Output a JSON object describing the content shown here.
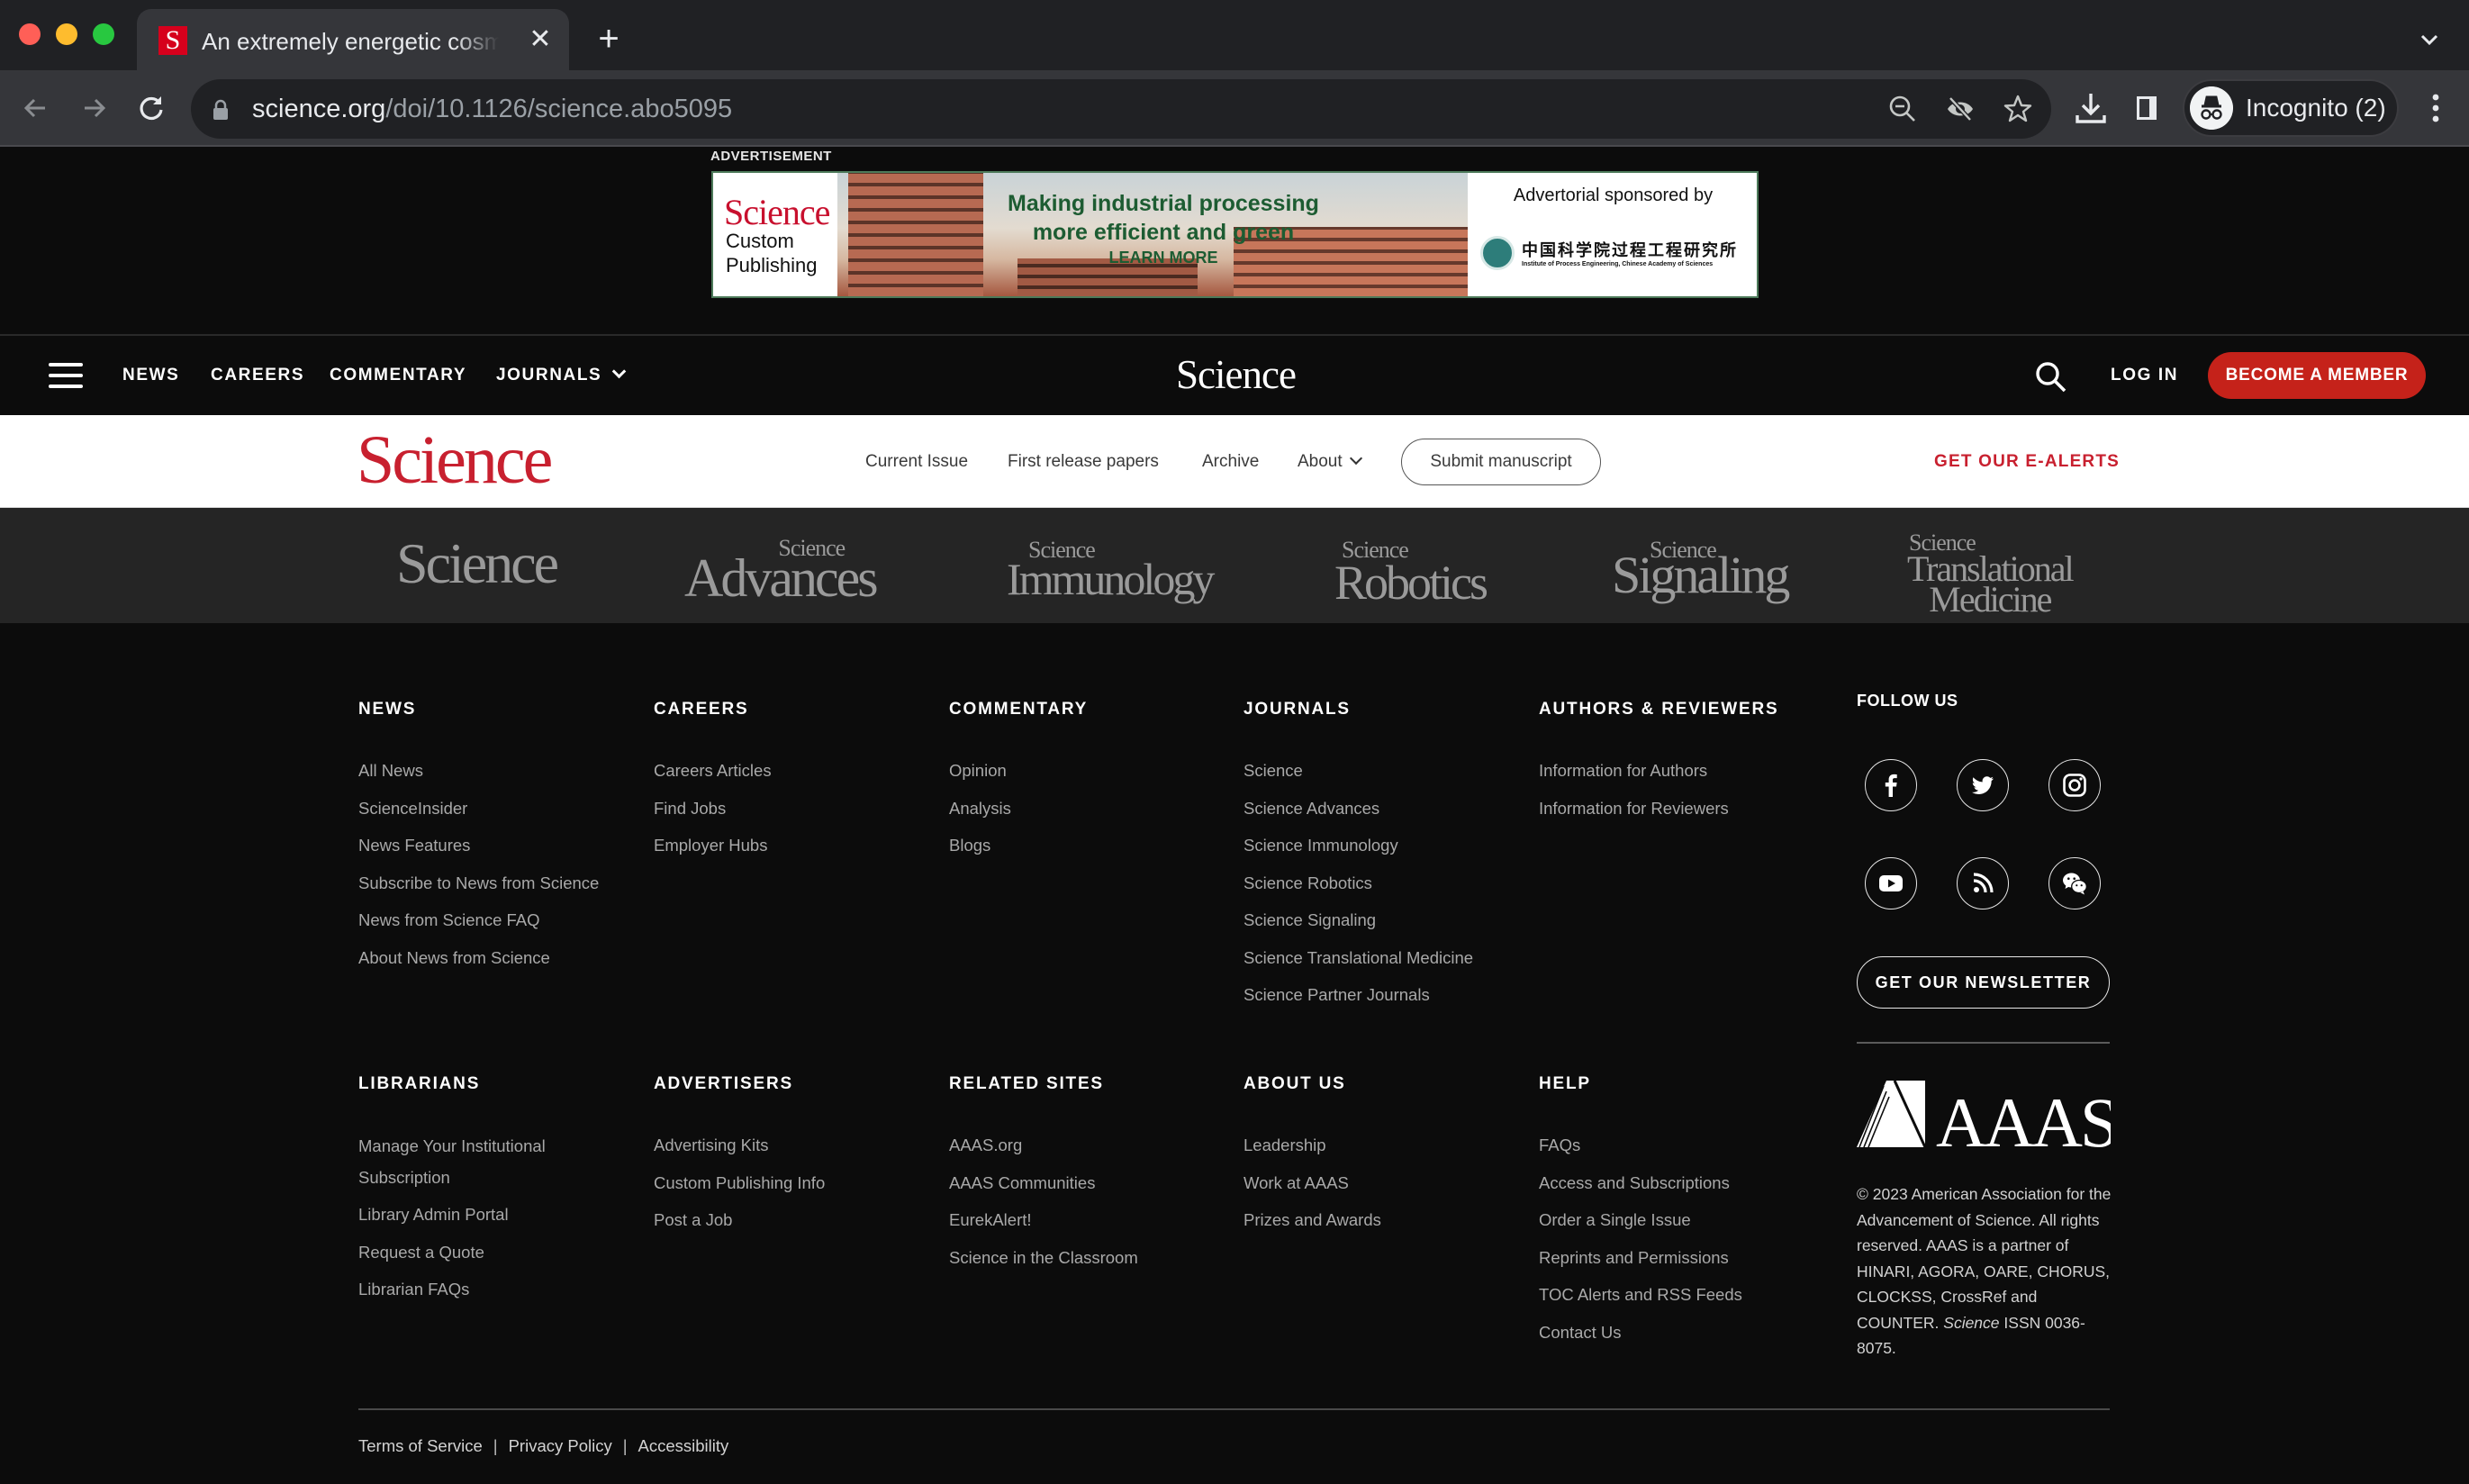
{
  "browser": {
    "tab_title": "An extremely energetic cosmic",
    "tab_favicon_letter": "S",
    "url_host": "science.org",
    "url_path": "/doi/10.1126/science.abo5095",
    "profile_label": "Incognito (2)"
  },
  "ad": {
    "label": "ADVERTISEMENT",
    "brand": "Science",
    "brand_sub_1": "Custom",
    "brand_sub_2": "Publishing",
    "headline_1": "Making industrial processing",
    "headline_2": "more efficient and green",
    "cta": "LEARN MORE",
    "sponsor_label": "Advertorial sponsored by",
    "sponsor_name_cn": "中国科学院过程工程研究所",
    "sponsor_name_en": "Institute of Process Engineering, Chinese Academy of Sciences"
  },
  "sitenav": {
    "links": [
      "NEWS",
      "CAREERS",
      "COMMENTARY",
      "JOURNALS"
    ],
    "brand": "Science",
    "login": "LOG IN",
    "member_button": "BECOME A MEMBER"
  },
  "journal_nav": {
    "logo": "Science",
    "links": [
      "Current Issue",
      "First release papers",
      "Archive",
      "About"
    ],
    "submit_button": "Submit manuscript",
    "ealerts": "GET OUR E-ALERTS"
  },
  "journal_strip": [
    {
      "prefix": "",
      "name": "Science"
    },
    {
      "prefix": "Science",
      "name": "Advances"
    },
    {
      "prefix": "Science",
      "name": "Immunology"
    },
    {
      "prefix": "Science",
      "name": "Robotics"
    },
    {
      "prefix": "Science",
      "name": "Signaling"
    },
    {
      "prefix": "Science",
      "name": "Translational",
      "name2": "Medicine"
    }
  ],
  "footer": {
    "columns_row1": [
      {
        "heading": "NEWS",
        "items": [
          "All News",
          "ScienceInsider",
          "News Features",
          "Subscribe to News from Science",
          "News from Science FAQ",
          "About News from Science"
        ]
      },
      {
        "heading": "CAREERS",
        "items": [
          "Careers Articles",
          "Find Jobs",
          "Employer Hubs"
        ]
      },
      {
        "heading": "COMMENTARY",
        "items": [
          "Opinion",
          "Analysis",
          "Blogs"
        ]
      },
      {
        "heading": "JOURNALS",
        "items": [
          "Science",
          "Science Advances",
          "Science Immunology",
          "Science Robotics",
          "Science Signaling",
          "Science Translational Medicine",
          "Science Partner Journals"
        ]
      },
      {
        "heading": "AUTHORS & REVIEWERS",
        "items": [
          "Information for Authors",
          "Information for Reviewers"
        ]
      }
    ],
    "columns_row2": [
      {
        "heading": "LIBRARIANS",
        "items": [
          "Manage Your Institutional Subscription",
          "Library Admin Portal",
          "Request a Quote",
          "Librarian FAQs"
        ]
      },
      {
        "heading": "ADVERTISERS",
        "items": [
          "Advertising Kits",
          "Custom Publishing Info",
          "Post a Job"
        ]
      },
      {
        "heading": "RELATED SITES",
        "items": [
          "AAAS.org",
          "AAAS Communities",
          "EurekAlert!",
          "Science in the Classroom"
        ]
      },
      {
        "heading": "ABOUT US",
        "items": [
          "Leadership",
          "Work at AAAS",
          "Prizes and Awards"
        ]
      },
      {
        "heading": "HELP",
        "items": [
          "FAQs",
          "Access and Subscriptions",
          "Order a Single Issue",
          "Reprints and Permissions",
          "TOC Alerts and RSS Feeds",
          "Contact Us"
        ]
      }
    ],
    "follow_heading": "FOLLOW US",
    "social": [
      "facebook",
      "twitter",
      "instagram",
      "youtube",
      "rss",
      "wechat"
    ],
    "newsletter_button": "GET OUR NEWSLETTER",
    "aaas_wordmark": "AAAS",
    "copyright_main": "© 2023 American Association for the Advancement of Science. All rights reserved. AAAS is a partner of HINARI, AGORA, OARE, CHORUS, CLOCKSS, CrossRef and COUNTER.",
    "copyright_journal": "Science",
    "copyright_issn": "ISSN 0036-8075.",
    "legal_links": [
      "Terms of Service",
      "Privacy Policy",
      "Accessibility"
    ]
  },
  "colors": {
    "brand_red": "#c8202f",
    "member_button": "#c5221a",
    "footer_bg": "#0c0c0c",
    "strip_bg": "#252525"
  }
}
